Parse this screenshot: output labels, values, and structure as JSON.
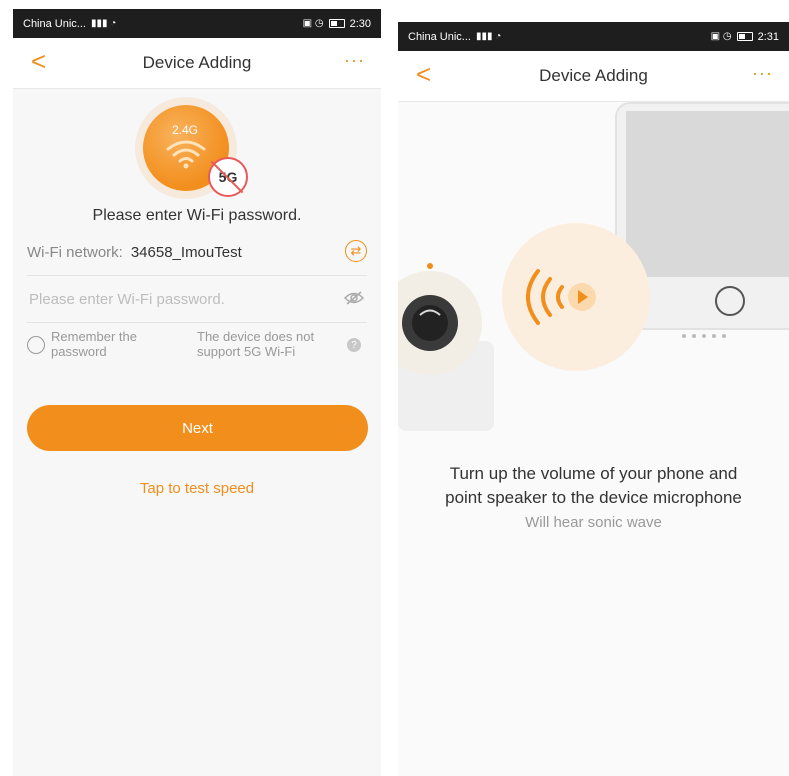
{
  "left": {
    "status": {
      "carrier": "China Unic...",
      "time": "2:30"
    },
    "nav": {
      "back": "<",
      "title": "Device Adding",
      "more": "···"
    },
    "badge": {
      "band": "2.4G",
      "blocked": "5G"
    },
    "prompt": "Please enter Wi-Fi password.",
    "wifi": {
      "label": "Wi-Fi network:",
      "value": "34658_ImouTest"
    },
    "password": {
      "placeholder": "Please enter Wi-Fi password.",
      "value": ""
    },
    "options": {
      "remember": "Remember the password",
      "no_5g": "The device does not support 5G Wi-Fi",
      "help": "?"
    },
    "next_label": "Next",
    "speed_link": "Tap to test speed"
  },
  "right": {
    "status": {
      "carrier": "China Unic...",
      "time": "2:31"
    },
    "nav": {
      "back": "<",
      "title": "Device Adding",
      "more": "···"
    },
    "instruction_line1": "Turn up the volume of your phone and",
    "instruction_line2": "point speaker to the device microphone",
    "sub": "Will hear sonic wave"
  },
  "colors": {
    "accent": "#f28e1c",
    "status_bar": "#1e1e1e",
    "danger": "#e85a5a"
  },
  "icons": [
    "back-chevron-icon",
    "more-icon",
    "wifi-icon",
    "switch-network-icon",
    "eye-hidden-icon",
    "help-icon",
    "sound-wave-icon",
    "camera-icon"
  ]
}
